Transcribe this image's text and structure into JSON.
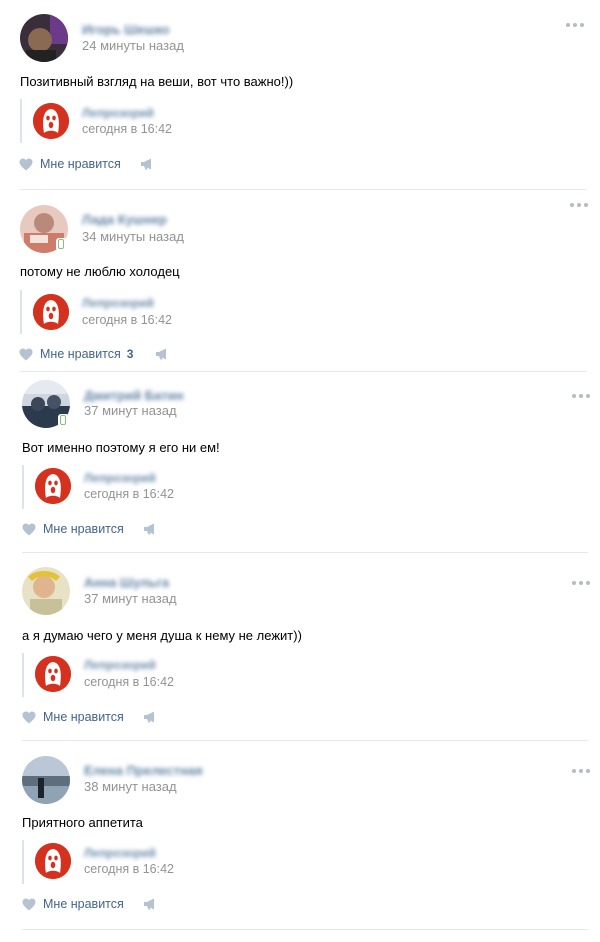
{
  "comments": [
    {
      "author": "Игорь Шешко",
      "time": "24 минуты назад",
      "text": "Позитивный взгляд на веши, вот что важно!))",
      "repost": {
        "name": "Лепрозорий",
        "time": "сегодня в 16:42"
      },
      "like_label": "Мне нравится",
      "like_count": ""
    },
    {
      "author": "Лада Кушнер",
      "time": "34 минуты назад",
      "text": "потому не люблю холодец",
      "repost": {
        "name": "Лепрозорий",
        "time": "сегодня в 16:42"
      },
      "like_label": "Мне нравится",
      "like_count": "3"
    },
    {
      "author": "Дмитрий Батин",
      "time": "37 минут назад",
      "text": "Вот именно поэтому я его ни ем!",
      "repost": {
        "name": "Лепрозорий",
        "time": "сегодня в 16:42"
      },
      "like_label": "Мне нравится",
      "like_count": ""
    },
    {
      "author": "Анна Шульга",
      "time": "37 минут назад",
      "text": "а я думаю чего у меня душа к нему не лежит))",
      "repost": {
        "name": "Лепрозорий",
        "time": "сегодня в 16:42"
      },
      "like_label": "Мне нравится",
      "like_count": ""
    },
    {
      "author": "Елена Прелестная",
      "time": "38 минут назад",
      "text": "Приятного аппетита",
      "repost": {
        "name": "Лепрозорий",
        "time": "сегодня в 16:42"
      },
      "like_label": "Мне нравится",
      "like_count": ""
    }
  ],
  "colors": {
    "link": "#2a5885",
    "meta": "#939393",
    "accent": "#d5311f",
    "separator": "#e7e8ec"
  },
  "icons": [
    "more-icon",
    "heart-icon",
    "share-icon",
    "scream-icon",
    "phone-icon"
  ]
}
